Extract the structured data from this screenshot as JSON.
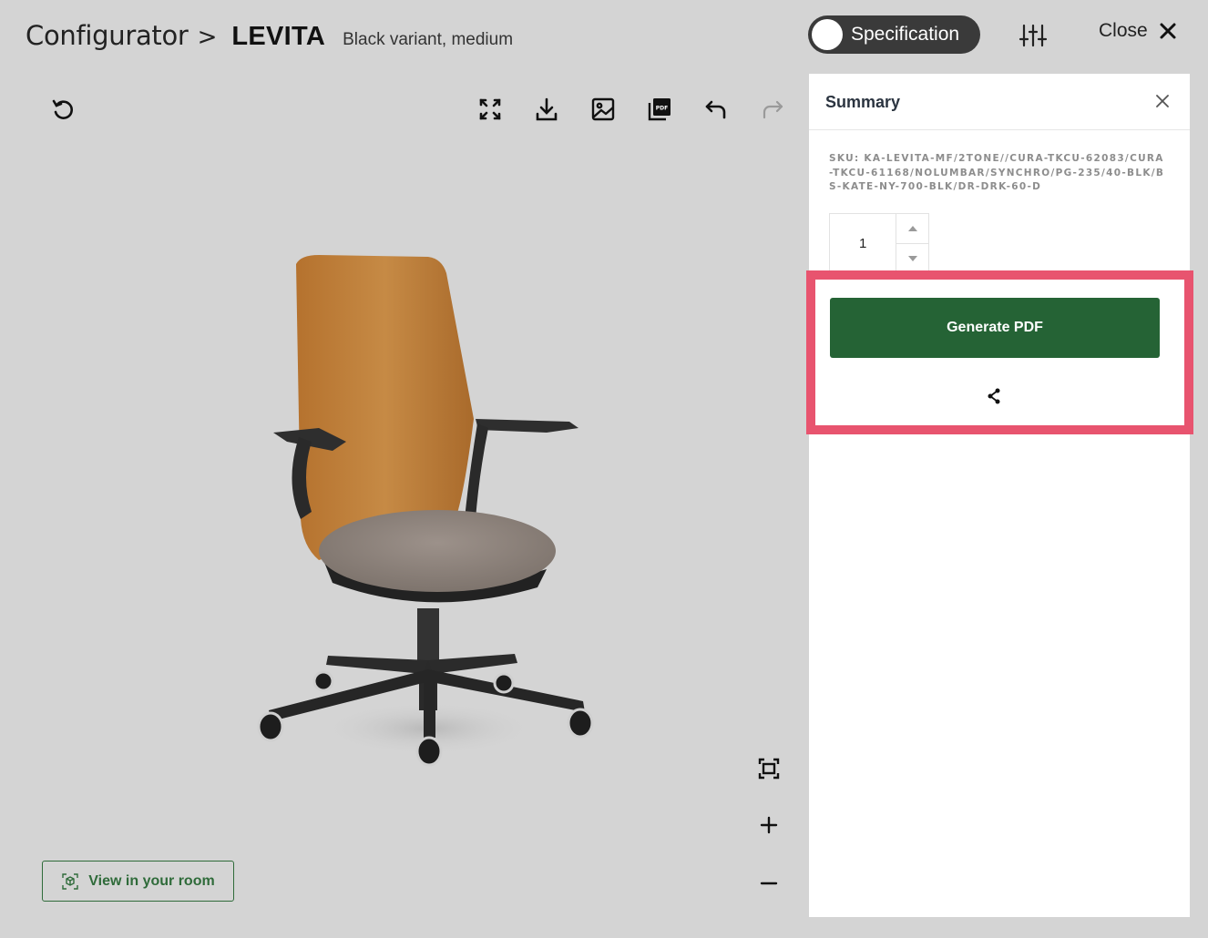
{
  "header": {
    "breadcrumb_root": "Configurator",
    "breadcrumb_separator": ">",
    "product": "LEVITA",
    "variant": "Black variant, medium",
    "spec_toggle_label": "Specification",
    "close_label": "Close"
  },
  "toolbar": {
    "icons": [
      "reset-icon",
      "fullscreen-icon",
      "download-icon",
      "image-icon",
      "pdf-icon",
      "undo-icon",
      "redo-icon"
    ]
  },
  "viewer": {
    "view_in_room_label": "View in your room",
    "zoom_controls": [
      "fit-icon",
      "zoom-in-icon",
      "zoom-out-icon"
    ]
  },
  "summary": {
    "title": "Summary",
    "sku": "SKU: KA-LEVITA-MF/2TONE//CURA-TKCU-62083/CURA-TKCU-61168/NOLUMBAR/SYNCHRO/PG-235/40-BLK/BS-KATE-NY-700-BLK/DR-DRK-60-D",
    "quantity": "1",
    "generate_pdf_label": "Generate PDF"
  },
  "colors": {
    "background": "#d4d4d4",
    "primary_green": "#256335",
    "highlight": "#e8546f",
    "toggle_dark": "#3a3a3a"
  }
}
